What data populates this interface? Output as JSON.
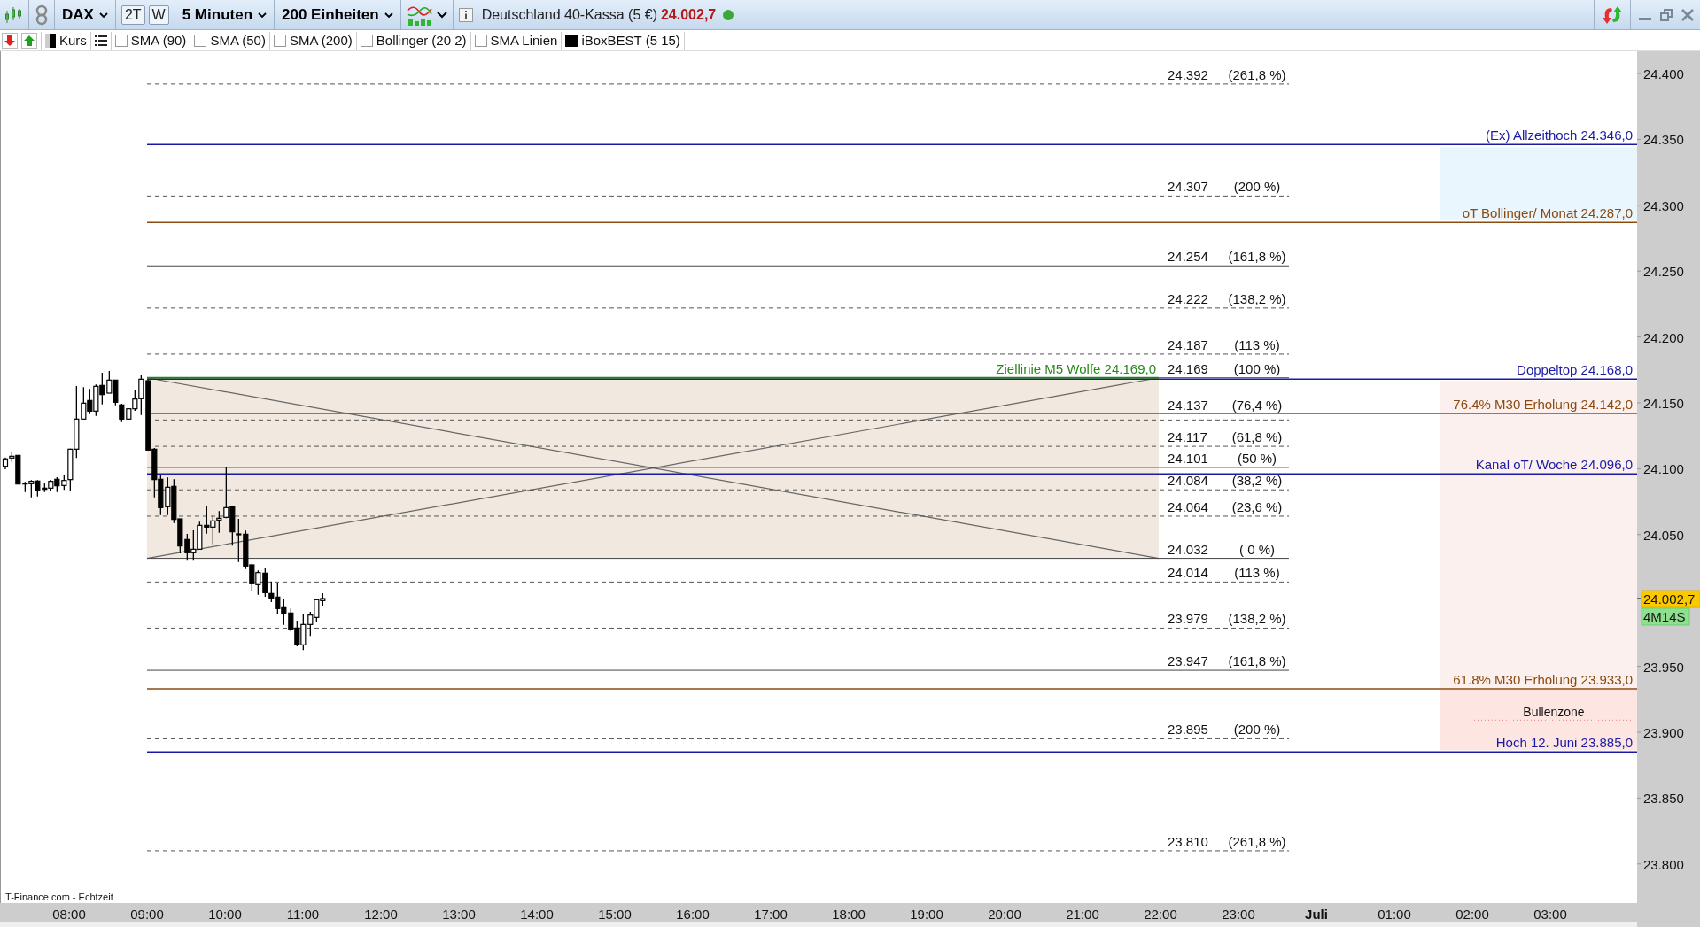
{
  "toolbar": {
    "symbol": "DAX",
    "buttons": [
      {
        "label": "2T"
      },
      {
        "label": "W"
      }
    ],
    "interval": "5 Minuten",
    "units": "200 Einheiten",
    "instrument": "Deutschland 40-Kassa (5 €)",
    "price": "24.002,7",
    "live": true
  },
  "indicators": {
    "price_label": "Kurs",
    "items": [
      {
        "label": "SMA (90)",
        "checked": false
      },
      {
        "label": "SMA (50)",
        "checked": false
      },
      {
        "label": "SMA (200)",
        "checked": false
      },
      {
        "label": "Bollinger (20 2)",
        "checked": false
      },
      {
        "label": "SMA Linien",
        "checked": false
      },
      {
        "label": "iBoxBEST (5 15)",
        "checked": true
      }
    ]
  },
  "chart": {
    "fib_levels": [
      {
        "price": "24.392",
        "percent": "(261,8 %)",
        "kind": "dashed"
      },
      {
        "price": "24.307",
        "percent": "(200 %)",
        "kind": "dashed"
      },
      {
        "price": "24.254",
        "percent": "(161,8 %)",
        "kind": "solid"
      },
      {
        "price": "24.222",
        "percent": "(138,2 %)",
        "kind": "dashed"
      },
      {
        "price": "24.187",
        "percent": "(113 %)",
        "kind": "dashed"
      },
      {
        "price": "24.169",
        "percent": "(100 %)",
        "kind": "solid"
      },
      {
        "price": "24.137",
        "percent": "(76,4 %)",
        "kind": "dashed"
      },
      {
        "price": "24.117",
        "percent": "(61,8 %)",
        "kind": "dashed"
      },
      {
        "price": "24.101",
        "percent": "(50 %)",
        "kind": "solid"
      },
      {
        "price": "24.084",
        "percent": "(38,2 %)",
        "kind": "dashed"
      },
      {
        "price": "24.064",
        "percent": "(23,6 %)",
        "kind": "dashed"
      },
      {
        "price": "24.032",
        "percent": "( 0 %)",
        "kind": "solid"
      },
      {
        "price": "24.014",
        "percent": "(113 %)",
        "kind": "dashed"
      },
      {
        "price": "23.979",
        "percent": "(138,2 %)",
        "kind": "dashed"
      },
      {
        "price": "23.947",
        "percent": "(161,8 %)",
        "kind": "solid"
      },
      {
        "price": "23.895",
        "percent": "(200 %)",
        "kind": "dashed"
      },
      {
        "price": "23.810",
        "percent": "(261,8 %)",
        "kind": "dashed"
      }
    ],
    "lines": [
      {
        "label": "(Ex) Allzeithoch 24.346,0",
        "color": "#1a1aa6"
      },
      {
        "label": "oT Bollinger/ Monat 24.287,0",
        "color": "#8b4a10"
      },
      {
        "label": "Doppeltop 24.168,0",
        "color": "#1a1aa6"
      },
      {
        "label": "76.4%  M30 Erholung 24.142,0",
        "color": "#8b4a10"
      },
      {
        "label": "Kanal oT/ Woche 24.096,0",
        "color": "#1a1aa6"
      },
      {
        "label": "61.8%  M30 Erholung 23.933,0",
        "color": "#8b4a10"
      },
      {
        "label": "Hoch 12. Juni 23.885,0",
        "color": "#1a1aa6"
      }
    ],
    "target_line": {
      "label": "Ziellinie M5 Wolfe 24.169,0"
    },
    "zone_label": "Bullenzone",
    "price_axis": [
      "24.400",
      "24.350",
      "24.300",
      "24.250",
      "24.200",
      "24.150",
      "24.100",
      "24.050",
      "23.950",
      "23.900",
      "23.850",
      "23.800"
    ],
    "current_price": "24.002,7",
    "countdown": "4M14S",
    "time_axis": [
      "08:00",
      "09:00",
      "10:00",
      "11:00",
      "12:00",
      "13:00",
      "14:00",
      "15:00",
      "16:00",
      "17:00",
      "18:00",
      "19:00",
      "20:00",
      "21:00",
      "22:00",
      "23:00",
      "Juli",
      "01:00",
      "02:00",
      "03:00"
    ],
    "source": "IT-Finance.com - Echtzeit"
  }
}
